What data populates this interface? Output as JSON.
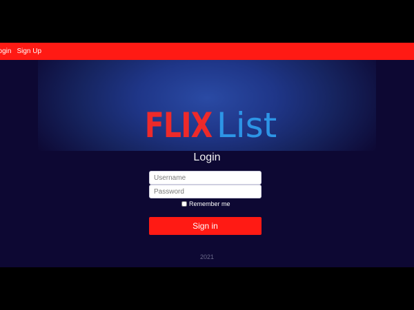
{
  "navbar": {
    "login_label": "Login",
    "signup_label": "Sign Up"
  },
  "logo": {
    "part1": "FLIX",
    "part2": "List"
  },
  "login_form": {
    "title": "Login",
    "username_placeholder": "Username",
    "password_placeholder": "Password",
    "remember_label": "Remember me",
    "signin_label": "Sign in"
  },
  "footer": {
    "year": "2021"
  },
  "colors": {
    "brand_red": "#ff1a14",
    "logo_red": "#ee2a2a",
    "logo_blue": "#2d95e6",
    "background": "#0d0833"
  }
}
